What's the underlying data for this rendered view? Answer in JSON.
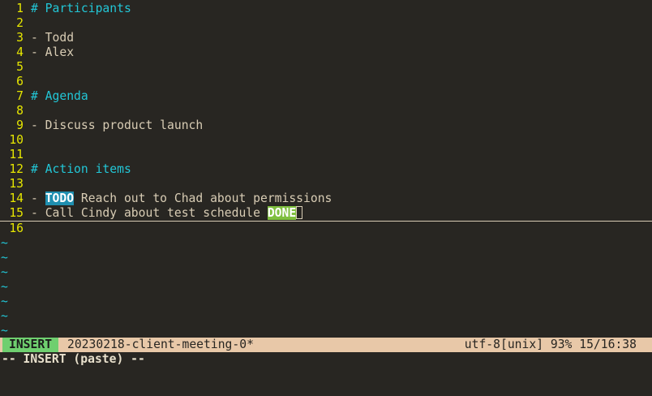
{
  "editor": {
    "lines": [
      {
        "num": "1",
        "text": "# Participants"
      },
      {
        "num": "2",
        "text": ""
      },
      {
        "num": "3",
        "text": "- Todd"
      },
      {
        "num": "4",
        "text": "- Alex"
      },
      {
        "num": "5",
        "text": ""
      },
      {
        "num": "6",
        "text": ""
      },
      {
        "num": "7",
        "text": "# Agenda"
      },
      {
        "num": "8",
        "text": ""
      },
      {
        "num": "9",
        "text": "- Discuss product launch"
      },
      {
        "num": "10",
        "text": ""
      },
      {
        "num": "11",
        "text": ""
      },
      {
        "num": "12",
        "text": "# Action items"
      },
      {
        "num": "13",
        "text": ""
      },
      {
        "num": "14",
        "dash": "- ",
        "tag": "TODO",
        "rest": " Reach out to Chad about permissions"
      },
      {
        "num": "15",
        "dash": "- ",
        "text": "Call Cindy about test schedule ",
        "tag": "DONE"
      },
      {
        "num": "16",
        "text": ""
      }
    ],
    "tilde": "~"
  },
  "statusline": {
    "mode": "INSERT",
    "filename": "20230218-client-meeting-0*",
    "right": "utf-8[unix] 93% 15/16:38"
  },
  "cmdline": "-- INSERT (paste) --",
  "colors": {
    "background": "#282622",
    "line_number": "#e6e600",
    "heading": "#22c6d6",
    "todo_bg": "#1f8fb0",
    "done_bg": "#7fbf3f",
    "statusline_bg": "#e8c8a8",
    "mode_bg": "#6fcf6f"
  }
}
